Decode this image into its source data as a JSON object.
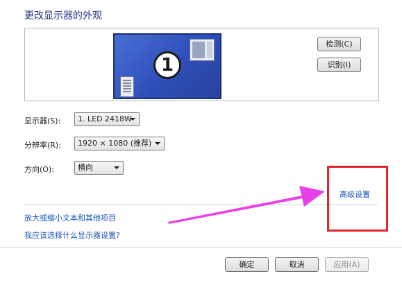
{
  "header": {
    "title": "更改显示器的外观"
  },
  "preview": {
    "monitor_number": "1",
    "detect_button": "检测(C)",
    "identify_button": "识别(I)"
  },
  "settings": {
    "display_label": "显示器(S):",
    "display_value": "1. LED 2418W",
    "resolution_label": "分辨率(R):",
    "resolution_value": "1920 × 1080 (推荐)",
    "orientation_label": "方向(O):",
    "orientation_value": "横向"
  },
  "links": {
    "advanced_settings": "高级设置",
    "make_text_larger": "放大或缩小文本和其他项目",
    "which_settings": "我应该选择什么显示器设置?"
  },
  "footer": {
    "ok_button": "确定",
    "cancel_button": "取消",
    "apply_button": "应用(A)"
  },
  "annotation": {
    "arrow_color": "#e83fe8",
    "box_color": "#e3262c"
  }
}
